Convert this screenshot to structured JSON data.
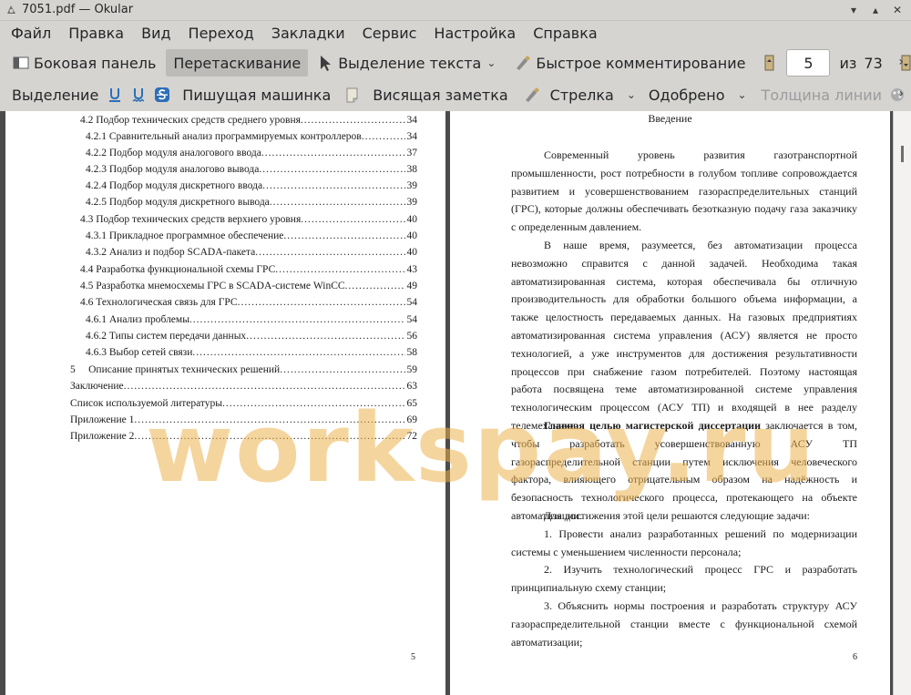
{
  "window": {
    "title": "7051.pdf  — Okular"
  },
  "menu": [
    "Файл",
    "Правка",
    "Вид",
    "Переход",
    "Закладки",
    "Сервис",
    "Настройка",
    "Справка"
  ],
  "toolbar1": {
    "sidebar": "Боковая панель",
    "drag": "Перетаскивание",
    "text_select": "Выделение текста",
    "quick_annot": "Быстрое комментирование",
    "page_current": "5",
    "page_of": "из",
    "page_total": "73"
  },
  "toolbar2": {
    "selection": "Выделение",
    "typewriter": "Пишущая машинка",
    "sticky": "Висящая заметка",
    "arrow": "Стрелка",
    "approved": "Одобрено",
    "line_width": "Толщина линии"
  },
  "watermark": "workspay.ru",
  "left_page": {
    "toc": [
      {
        "t": "4.2 Подбор технических средств среднего уровня",
        "p": "34"
      },
      {
        "t": "4.2.1 Сравнительный анализ программируемых контроллеров",
        "p": "34"
      },
      {
        "t": "4.2.2 Подбор модуля аналогового ввода",
        "p": "37"
      },
      {
        "t": "4.2.3 Подбор модуля аналогово вывода",
        "p": "38"
      },
      {
        "t": "4.2.4 Подбор модуля дискретного ввода",
        "p": "39"
      },
      {
        "t": "4.2.5 Подбор модуля дискретного вывода",
        "p": "39"
      },
      {
        "t": "4.3 Подбор технических средств верхнего уровня",
        "p": "40"
      },
      {
        "t": "4.3.1 Прикладное программное обеспечение",
        "p": "40"
      },
      {
        "t": "4.3.2 Анализ и подбор SCADA-пакета",
        "p": "40"
      },
      {
        "t": "4.4 Разработка функциональной схемы ГРС",
        "p": "43"
      },
      {
        "t": "4.5 Разработка мнемосхемы ГРС в SCADA-системе WinCC",
        "p": "49"
      },
      {
        "t": "4.6 Технологическая связь для ГРС",
        "p": "54"
      },
      {
        "t": "4.6.1 Анализ проблемы",
        "p": "54"
      },
      {
        "t": "4.6.2 Типы систем передачи данных",
        "p": "56"
      },
      {
        "t": "4.6.3 Выбор сетей связи",
        "p": "58"
      },
      {
        "t": "5     Описание принятых технических решений",
        "p": "59"
      },
      {
        "t": "Заключение",
        "p": "63"
      },
      {
        "t": "Список используемой литературы",
        "p": "65"
      },
      {
        "t": "Приложение 1",
        "p": "69"
      },
      {
        "t": "Приложение 2",
        "p": "72"
      }
    ],
    "page_number": "5"
  },
  "right_page": {
    "heading": "Введение",
    "p1": "Современный уровень развития газотранспортной промышленности, рост потребности в голубом топливе сопровождается развитием и усовершенствованием газораспределительных станций (ГРС), которые должны обеспечивать безотказную подачу газа заказчику с определенным давлением.",
    "p2": "В наше время, разумеется, без автоматизации процесса невозможно справится с данной задачей. Необходима такая автоматизированная система, которая обеспечивала бы отличную производительность для обработки большого объема информации, а также целостность передаваемых данных. На газовых предприятиях автоматизированная система управления (АСУ) является не просто технологией, а уже инструментов для достижения результативности процессов при снабжение газом потребителей. Поэтому настоящая работа посвящена теме автоматизированной системе управления технологическим процессом (АСУ ТП) и входящей в нее разделу телемеханики.",
    "p3_bold": "Главная целью магистерской диссертации",
    "p3_rest": " заключается в том, чтобы разработать усовершенствованную АСУ ТП газораспределительной станции путем исключения человеческого фактора, влияющего отрицательным образом на надёжность и безопасность технологического процесса, протекающего на объекте автоматизации.",
    "p4": "Для достижения этой цели решаются следующие задачи:",
    "p5": "1. Провести анализ разработанных решений по модернизации системы с уменьшением численности персонала;",
    "p6": "2. Изучить технологический процесс ГРС и разработать принципиальную схему станции;",
    "p7": "3. Объяснить нормы построения и разработать структуру АСУ газораспределительной станции вместе с функциональной схемой автоматизации;",
    "page_number": "6"
  }
}
